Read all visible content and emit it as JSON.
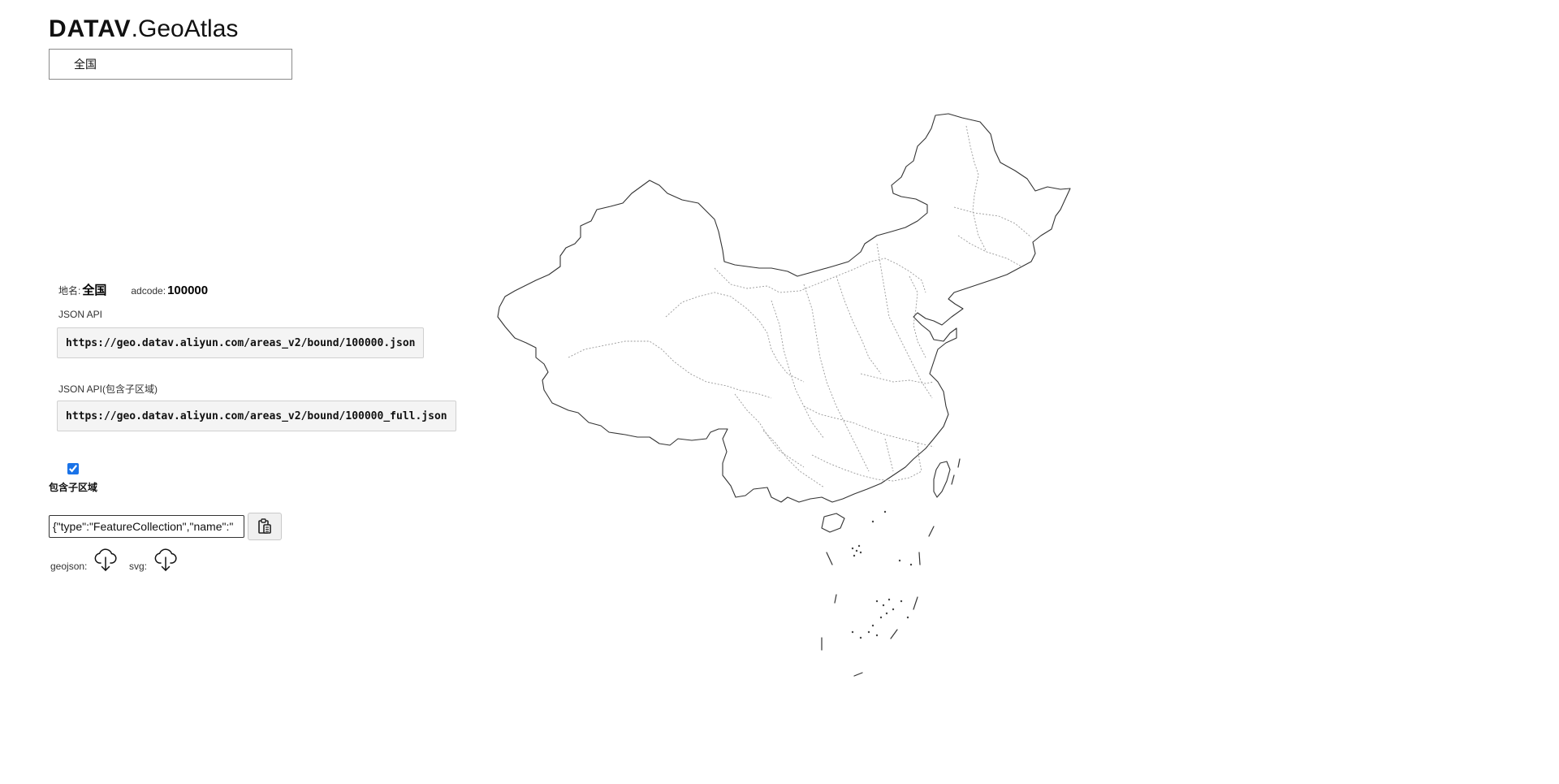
{
  "logo": {
    "bold": "DATAV",
    "light": ".GeoAtlas"
  },
  "region_select": {
    "value": "全国"
  },
  "info": {
    "name_label": "地名:",
    "name_value": "全国",
    "adcode_label": "adcode:",
    "adcode_value": "100000"
  },
  "api": {
    "label": "JSON API",
    "url": "https://geo.datav.aliyun.com/areas_v2/bound/100000.json",
    "full_label": "JSON API(包含子区域)",
    "full_url": "https://geo.datav.aliyun.com/areas_v2/bound/100000_full.json"
  },
  "include_subregions": {
    "checked": true,
    "label": "包含子区域"
  },
  "json_output": {
    "value": "{\"type\":\"FeatureCollection\",\"name\":\""
  },
  "downloads": {
    "geojson_label": "geojson:",
    "svg_label": "svg:"
  },
  "icons": {
    "copy": "clipboard-icon",
    "download": "cloud-download-icon"
  },
  "colors": {
    "accent": "#1a73e8",
    "map_stroke": "#333333",
    "map_inner_stroke": "#999999"
  }
}
